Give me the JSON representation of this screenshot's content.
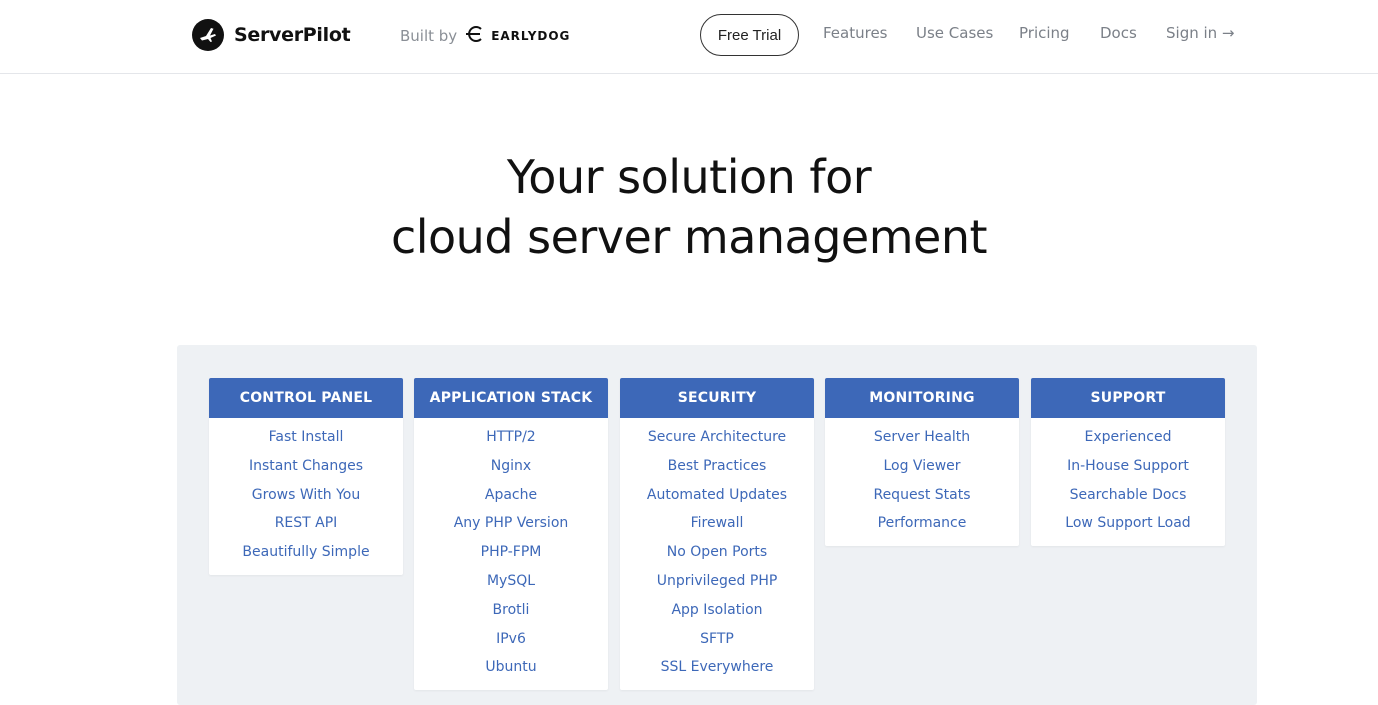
{
  "header": {
    "logo_text": "ServerPilot",
    "built_by_prefix": "Built by",
    "built_by_company": "EARLYDOG",
    "nav": {
      "free_trial": "Free Trial",
      "features": "Features",
      "use_cases": "Use Cases",
      "pricing": "Pricing",
      "docs": "Docs",
      "sign_in": "Sign in →"
    }
  },
  "hero": {
    "line1": "Your solution for",
    "line2": "cloud server management"
  },
  "columns": [
    {
      "title": "CONTROL PANEL",
      "items": [
        "Fast Install",
        "Instant Changes",
        "Grows With You",
        "REST API",
        "Beautifully Simple"
      ]
    },
    {
      "title": "APPLICATION STACK",
      "items": [
        "HTTP/2",
        "Nginx",
        "Apache",
        "Any PHP Version",
        "PHP-FPM",
        "MySQL",
        "Brotli",
        "IPv6",
        "Ubuntu"
      ]
    },
    {
      "title": "SECURITY",
      "items": [
        "Secure Architecture",
        "Best Practices",
        "Automated Updates",
        "Firewall",
        "No Open Ports",
        "Unprivileged PHP",
        "App Isolation",
        "SFTP",
        "SSL Everywhere"
      ]
    },
    {
      "title": "MONITORING",
      "items": [
        "Server Health",
        "Log Viewer",
        "Request Stats",
        "Performance"
      ]
    },
    {
      "title": "SUPPORT",
      "items": [
        "Experienced",
        "In-House Support",
        "Searchable Docs",
        "Low Support Load"
      ]
    }
  ],
  "colors": {
    "accent": "#3d68b8",
    "panel_bg": "#eef1f4",
    "nav_text": "#7b8088"
  }
}
